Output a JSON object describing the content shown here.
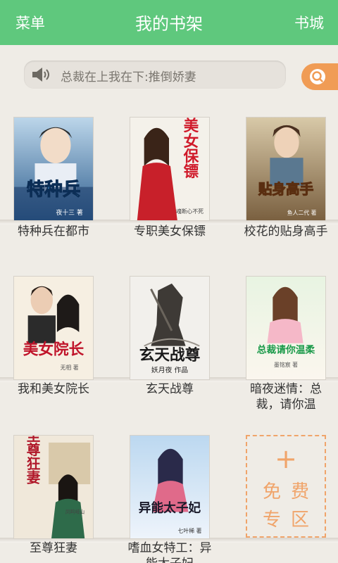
{
  "topbar": {
    "menu": "菜单",
    "title": "我的书架",
    "store": "书城"
  },
  "notice": {
    "text": "总裁在上我在下:推倒娇妻"
  },
  "icons": {
    "speaker": "speaker-icon",
    "search": "search-icon"
  },
  "books": [
    {
      "title": "特种兵在都市",
      "cover_text": "特种兵",
      "cover_author": "夜十三 著"
    },
    {
      "title": "专职美女保镖",
      "cover_text": "美女保镖",
      "cover_author": "魂断心不死"
    },
    {
      "title": "校花的贴身高手",
      "cover_text": "贴身高手",
      "cover_author": "鱼人二代 著"
    },
    {
      "title": "我和美女院长",
      "cover_text": "美女院长",
      "cover_author": "无相 著"
    },
    {
      "title": "玄天战尊",
      "cover_text": "玄天战尊",
      "cover_author": "妖月夜 作品"
    },
    {
      "title": "暗夜迷情：总裁，请你温",
      "cover_text": "总裁请你温柔",
      "cover_author": "墨铭宸 著"
    },
    {
      "title": "至尊狂妻",
      "cover_text": "至尊狂妻",
      "cover_author": "凤鸣岐山"
    },
    {
      "title": "嗜血女特工：异能太子妃",
      "cover_text": "异能太子妃",
      "cover_author": "七叶稀 著"
    }
  ],
  "free_zone": {
    "plus": "+",
    "line1": "免费",
    "line2": "专区"
  },
  "colors": {
    "header": "#5fc87d",
    "accent": "#f09c55",
    "free_border": "#f0a46a"
  }
}
